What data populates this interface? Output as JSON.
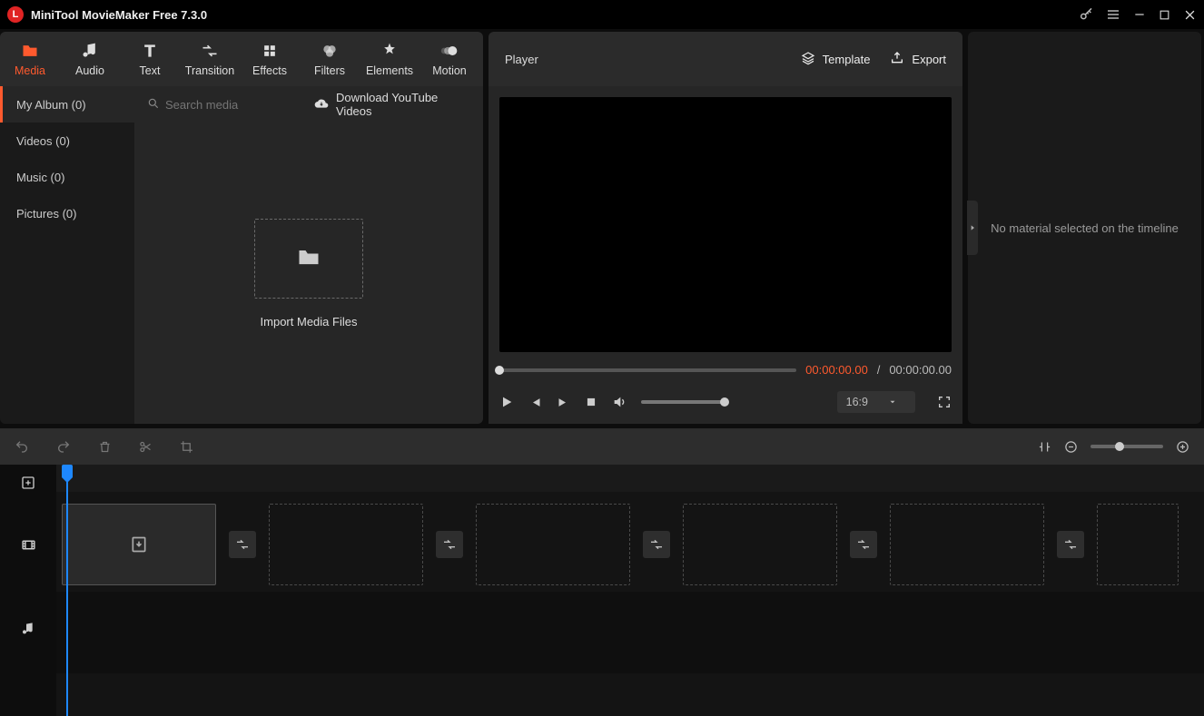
{
  "app": {
    "title": "MiniTool MovieMaker Free 7.3.0"
  },
  "tabs": {
    "media": {
      "label": "Media"
    },
    "audio": {
      "label": "Audio"
    },
    "text": {
      "label": "Text"
    },
    "transition": {
      "label": "Transition"
    },
    "effects": {
      "label": "Effects"
    },
    "filters": {
      "label": "Filters"
    },
    "elements": {
      "label": "Elements"
    },
    "motion": {
      "label": "Motion"
    }
  },
  "sidebar": {
    "items": [
      {
        "label": "My Album (0)"
      },
      {
        "label": "Videos (0)"
      },
      {
        "label": "Music (0)"
      },
      {
        "label": "Pictures (0)"
      }
    ]
  },
  "media": {
    "search_placeholder": "Search media",
    "yt_download": "Download YouTube Videos",
    "import_label": "Import Media Files"
  },
  "player": {
    "title": "Player",
    "template_label": "Template",
    "export_label": "Export",
    "time_current": "00:00:00.00",
    "time_sep": "/",
    "time_total": "00:00:00.00",
    "aspect": "16:9"
  },
  "inspector": {
    "empty_message": "No material selected on the timeline"
  }
}
